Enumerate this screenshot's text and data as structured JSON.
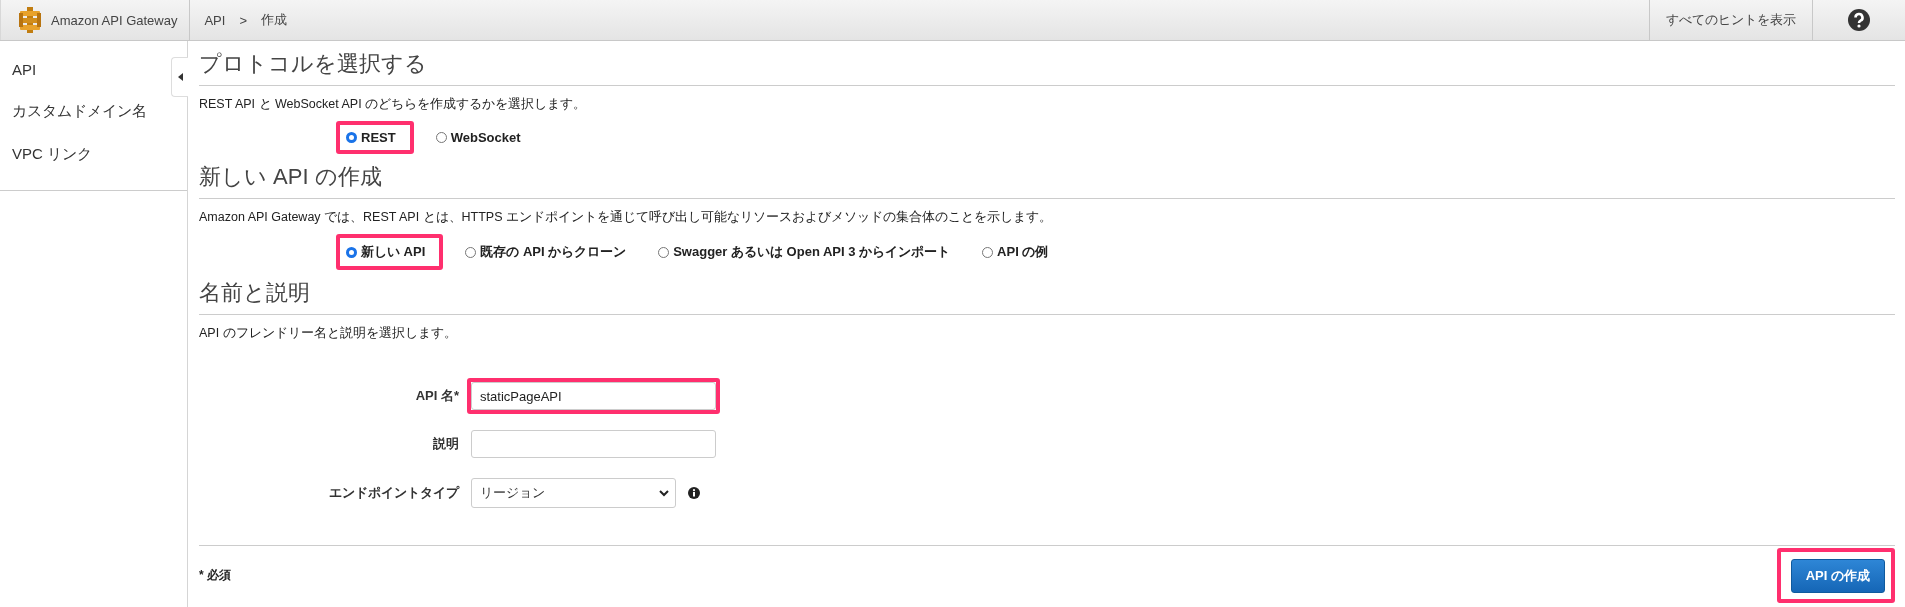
{
  "top_bar": {
    "service_name": "Amazon API Gateway",
    "breadcrumb": [
      "API",
      ">",
      "作成"
    ],
    "hints_button": "すべてのヒントを表示"
  },
  "sidebar": {
    "items": [
      {
        "label": "API"
      },
      {
        "label": "カスタムドメイン名"
      },
      {
        "label": "VPC リンク"
      }
    ]
  },
  "sections": [
    {
      "title": "プロトコルを選択する",
      "description": "REST API と WebSocket API のどちらを作成するかを選択します。",
      "options": [
        {
          "label": "REST",
          "selected": true,
          "highlighted": true
        },
        {
          "label": "WebSocket",
          "selected": false
        }
      ]
    },
    {
      "title": "新しい API の作成",
      "description": "Amazon API Gateway では、REST API とは、HTTPS エンドポイントを通じて呼び出し可能なリソースおよびメソッドの集合体のことを示します。",
      "options": [
        {
          "label": "新しい API",
          "selected": true,
          "highlighted": true
        },
        {
          "label": "既存の API からクローン",
          "selected": false
        },
        {
          "label": "Swagger あるいは Open API 3 からインポート",
          "selected": false
        },
        {
          "label": "API の例",
          "selected": false
        }
      ]
    },
    {
      "title": "名前と説明",
      "description": "API のフレンドリー名と説明を選択します。"
    }
  ],
  "form": {
    "fields": [
      {
        "kind": "text",
        "label": "API 名*",
        "value": "staticPageAPI",
        "highlighted": true
      },
      {
        "kind": "text",
        "label": "説明"
      },
      {
        "kind": "select",
        "label": "エンドポイントタイプ",
        "value": "リージョン",
        "info": true
      }
    ]
  },
  "footer": {
    "required_note": "* 必須",
    "create_button": {
      "label": "API の作成",
      "highlighted": true
    }
  }
}
